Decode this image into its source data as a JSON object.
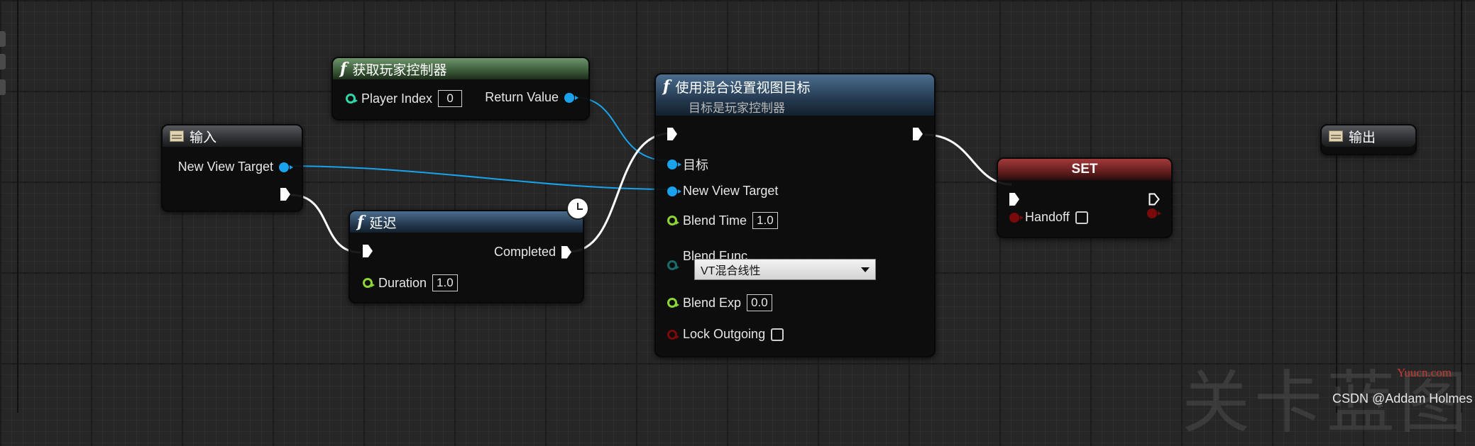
{
  "nodes": {
    "get_controller": {
      "title": "获取玩家控制器",
      "player_index_label": "Player Index",
      "player_index_value": "0",
      "return_label": "Return Value"
    },
    "input": {
      "title": "输入",
      "new_view_target_label": "New View Target"
    },
    "delay": {
      "title": "延迟",
      "completed_label": "Completed",
      "duration_label": "Duration",
      "duration_value": "1.0"
    },
    "set_view_target": {
      "title": "使用混合设置视图目标",
      "subtitle": "目标是玩家控制器",
      "target_label": "目标",
      "new_view_target_label": "New View Target",
      "blend_time_label": "Blend Time",
      "blend_time_value": "1.0",
      "blend_func_label": "Blend Func",
      "blend_func_value": "VT混合线性",
      "blend_exp_label": "Blend Exp",
      "blend_exp_value": "0.0",
      "lock_outgoing_label": "Lock Outgoing"
    },
    "set": {
      "title": "SET",
      "handoff_label": "Handoff"
    },
    "output": {
      "title": "输出"
    }
  },
  "watermark": {
    "big_text": "关卡蓝图",
    "site": "Yuucn.com",
    "csdn": "CSDN @Addam Holmes"
  },
  "colors": {
    "object_pin": "#1aa3ec",
    "float_pin": "#8dd534",
    "bool_pin": "#7a0a0a",
    "enum_pin": "#1b6a6a",
    "exec_pin": "#ffffff"
  },
  "icons": {
    "function": "function-f-icon",
    "entry": "entry-tunnel-icon",
    "latent": "clock-icon"
  }
}
